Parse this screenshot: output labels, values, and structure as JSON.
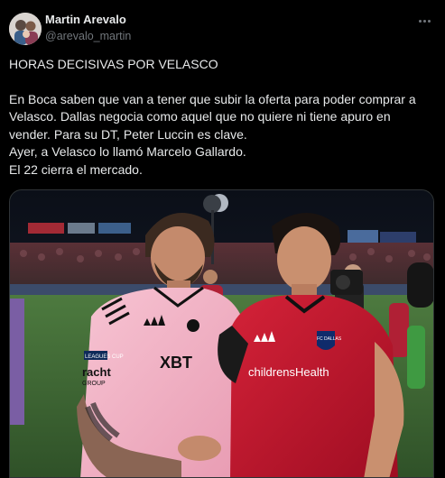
{
  "author": {
    "display_name": "Martin Arevalo",
    "handle": "@arevalo_martin"
  },
  "tweet": {
    "lines": [
      "HORAS DECISIVAS POR VELASCO",
      "",
      "En Boca saben que van a tener que subir la oferta para poder comprar a",
      "Velasco. Dallas negocia como aquel que no quiere ni tiene apuro en",
      "vender. Para su DT, Peter Luccin es clave.",
      "Ayer, a Velasco lo llamó Marcelo Gallardo.",
      "El 22 cierra el mercado."
    ]
  },
  "media": {
    "left_jersey_sponsor": "XBT",
    "left_jersey_sleeve": "racht",
    "left_jersey_sleeve_sub": "GROUP",
    "right_jersey_sponsor": "childrensHealth",
    "right_jersey_crest": "FC DALLAS",
    "left_jersey_patch": "LEAGUES CUP"
  },
  "colors": {
    "background": "#000000",
    "text": "#e7e9ea",
    "secondary": "#71767b",
    "pink_jersey": "#f4b7c8",
    "red_jersey": "#c8102e",
    "pitch": "#3f6b34"
  },
  "icons": {
    "more": "more-horizontal-icon"
  }
}
